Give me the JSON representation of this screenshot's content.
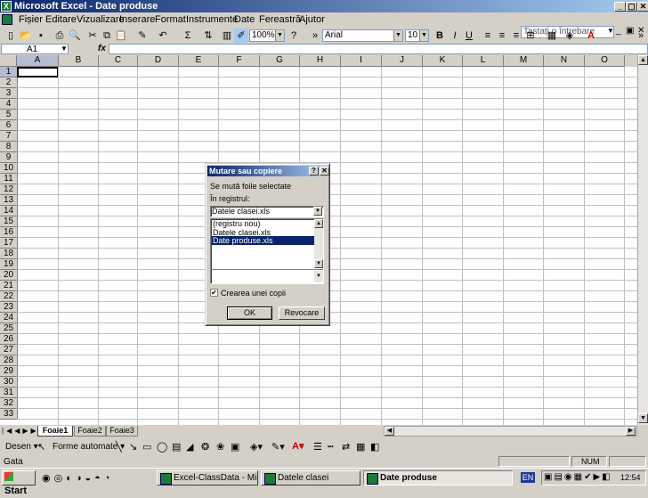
{
  "window": {
    "title": "Microsoft Excel - Date produse",
    "min": "_",
    "max": "▢",
    "close": "✕"
  },
  "menu": {
    "items": [
      "Fișier",
      "Editare",
      "Vizualizare",
      "Inserare",
      "Format",
      "Instrumente",
      "Date",
      "Fereastră",
      "Ajutor"
    ],
    "help_placeholder": "Tastați o întrebare"
  },
  "toolbar": {
    "zoom": "100%",
    "font": "Arial",
    "size": "10"
  },
  "formula_bar": {
    "cell_ref": "A1",
    "fx": "fx",
    "value": ""
  },
  "grid": {
    "columns": [
      "A",
      "B",
      "C",
      "D",
      "E",
      "F",
      "G",
      "H",
      "I",
      "J",
      "K",
      "L",
      "M",
      "N",
      "O"
    ],
    "rows": [
      "1",
      "2",
      "3",
      "4",
      "5",
      "6",
      "7",
      "8",
      "9",
      "10",
      "11",
      "12",
      "13",
      "14",
      "15",
      "16",
      "17",
      "18",
      "19",
      "20",
      "21",
      "22",
      "23",
      "24",
      "25",
      "26",
      "27",
      "28",
      "29",
      "30",
      "31",
      "32",
      "33"
    ]
  },
  "sheets": {
    "tabs": [
      "Foaie1",
      "Foaie2",
      "Foaie3"
    ],
    "active": "Foaie1"
  },
  "drawing": {
    "draw_label": "Desen",
    "autoshapes_label": "Forme automate"
  },
  "status": {
    "ready": "Gata",
    "num": "NUM"
  },
  "dialog": {
    "title": "Mutare sau copiere",
    "help": "?",
    "close": "✕",
    "move_label": "Se mută foile selectate",
    "workbook_label": "În registrul:",
    "workbook_value": "Datele clasei.xls",
    "list_items": [
      "(registru nou)",
      "Datele clasei.xls",
      "Date produse.xls"
    ],
    "selected_index": 2,
    "copy_checked": true,
    "copy_label": "Crearea unei copii",
    "ok": "OK",
    "cancel": "Revocare"
  },
  "taskbar": {
    "start": "Start",
    "tasks": [
      "Excel-ClassData - Micros...",
      "Datele clasei",
      "Date produse"
    ],
    "active_task": 2,
    "lang": "EN",
    "time": "12:54"
  }
}
